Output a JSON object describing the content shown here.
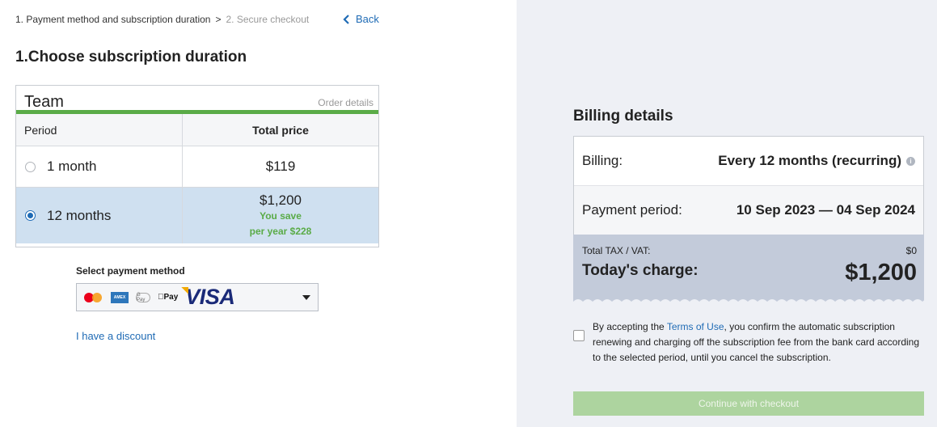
{
  "breadcrumb": {
    "step1": "1. Payment method and subscription duration",
    "separator": ">",
    "step2": "2. Secure checkout"
  },
  "back_label": "Back",
  "section_title": "1.Choose subscription duration",
  "plan": {
    "name": "Team",
    "order_details": "Order details",
    "col_period": "Period",
    "col_price": "Total price",
    "options": [
      {
        "period": "1 month",
        "price": "$119",
        "selected": false
      },
      {
        "period": "12 months",
        "price": "$1,200",
        "save_line1": "You save",
        "save_line2": "per year $228",
        "selected": true
      }
    ]
  },
  "payment": {
    "label": "Select payment method",
    "selected_brand": "VISA",
    "other_methods": [
      "Mastercard",
      "Amex",
      "GPay",
      "Pay"
    ]
  },
  "discount_label": "I have a discount",
  "billing": {
    "title": "Billing details",
    "billing_label": "Billing:",
    "billing_value": "Every 12 months (recurring)",
    "period_label": "Payment period:",
    "period_value": "10 Sep 2023 — 04 Sep 2024",
    "tax_label": "Total TAX / VAT:",
    "tax_value": "$0",
    "today_label": "Today's charge:",
    "today_value": "$1,200"
  },
  "terms": {
    "prefix": "By accepting the ",
    "link": "Terms of Use",
    "suffix": ", you confirm the automatic subscription renewing and charging off the subscription fee from the bank card according to the selected period, until you cancel the subscription."
  },
  "continue_label": "Continue with checkout",
  "colors": {
    "accent_blue": "#1f6bb5",
    "green": "#5aab47",
    "selected_row": "#cfe0f0",
    "right_panel": "#eef0f5",
    "charge_panel": "#c3cbda",
    "disabled_button": "#add49f"
  }
}
